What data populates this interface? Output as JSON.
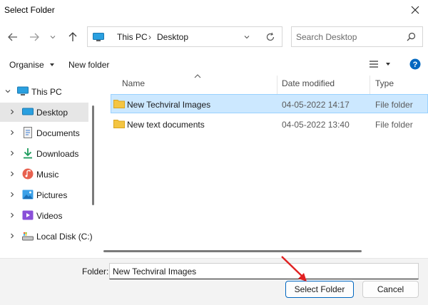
{
  "window": {
    "title": "Select Folder"
  },
  "address": {
    "crumbs": [
      "This PC",
      "Desktop"
    ]
  },
  "search": {
    "placeholder": "Search Desktop"
  },
  "commands": {
    "organise": "Organise",
    "new_folder": "New folder"
  },
  "tree": {
    "root": "This PC",
    "items": [
      {
        "label": "Desktop",
        "icon": "desktop-icon",
        "selected": true
      },
      {
        "label": "Documents",
        "icon": "documents-icon"
      },
      {
        "label": "Downloads",
        "icon": "downloads-icon"
      },
      {
        "label": "Music",
        "icon": "music-icon"
      },
      {
        "label": "Pictures",
        "icon": "pictures-icon"
      },
      {
        "label": "Videos",
        "icon": "videos-icon"
      },
      {
        "label": "Local Disk (C:)",
        "icon": "local-disk-icon"
      }
    ]
  },
  "columns": {
    "name": "Name",
    "date": "Date modified",
    "type": "Type"
  },
  "files": [
    {
      "name": "New Techviral Images",
      "date": "04-05-2022 14:17",
      "type": "File folder",
      "selected": true
    },
    {
      "name": "New text documents",
      "date": "04-05-2022 13:40",
      "type": "File folder"
    }
  ],
  "footer": {
    "folder_label": "Folder:",
    "folder_value": "New Techviral Images",
    "select_button": "Select Folder",
    "cancel_button": "Cancel"
  },
  "colors": {
    "accent": "#0067c0",
    "selection": "#cce8ff",
    "folder": "#f4c542",
    "annotation_arrow": "#e02020"
  }
}
